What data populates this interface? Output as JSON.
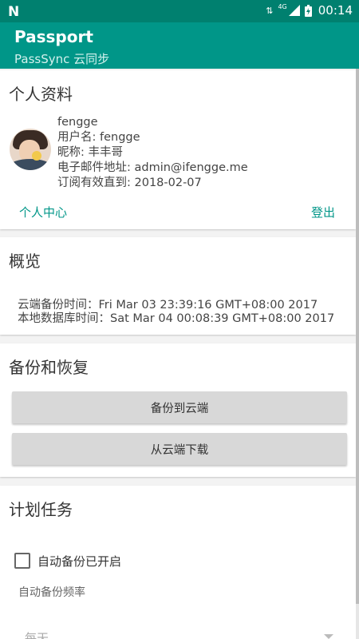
{
  "statusbar": {
    "logo": "N",
    "network": "4G",
    "time": "00:14"
  },
  "app": {
    "title": "Passport",
    "subtitle": "PassSync 云同步"
  },
  "profile": {
    "title": "个人资料",
    "username_display": "fengge",
    "username_line": "用户名: fengge",
    "nickname_line": "昵称: 丰丰哥",
    "email_line": "电子邮件地址: admin@ifengge.me",
    "subscription_line": "订阅有效直到: 2018-02-07",
    "center_link": "个人中心",
    "logout_link": "登出"
  },
  "overview": {
    "title": "概览",
    "cloud_backup_line": "云端备份时间：Fri Mar 03 23:39:16 GMT+08:00 2017",
    "local_db_line": "本地数据库时间：Sat Mar 04 00:08:39 GMT+08:00 2017"
  },
  "backup": {
    "title": "备份和恢复",
    "backup_button": "备份到云端",
    "download_button": "从云端下载"
  },
  "schedule": {
    "title": "计划任务",
    "auto_backup_label": "自动备份已开启",
    "auto_backup_checked": false,
    "frequency_label": "自动备份频率",
    "frequency_value": "每天"
  }
}
